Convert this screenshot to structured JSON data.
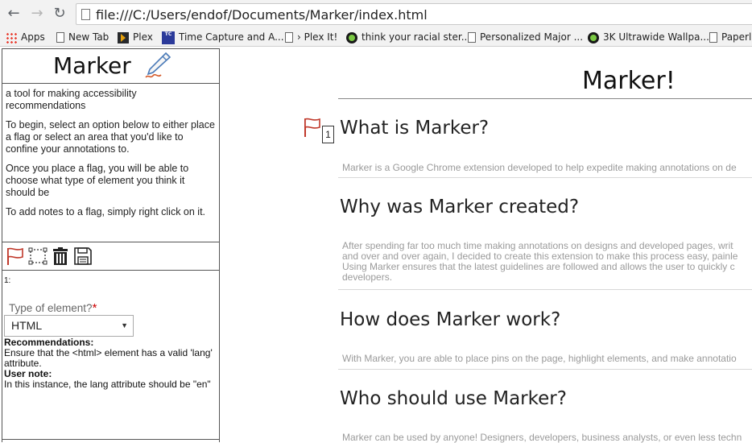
{
  "browser": {
    "url": "file:///C:/Users/endof/Documents/Marker/index.html",
    "bookmarks": [
      {
        "label": "Apps",
        "icon": "apps-grid-icon"
      },
      {
        "label": "New Tab",
        "icon": "page-icon"
      },
      {
        "label": "Plex",
        "icon": "plex-icon"
      },
      {
        "label": "Time Capture and A...",
        "icon": "time-capture-icon"
      },
      {
        "label": "› Plex It!",
        "icon": "page-icon"
      },
      {
        "label": "think your racial ster...",
        "icon": "green-circle-icon"
      },
      {
        "label": "Personalized Major ...",
        "icon": "page-icon"
      },
      {
        "label": "3K Ultrawide Wallpa...",
        "icon": "green-circle-icon"
      },
      {
        "label": "Paperle",
        "icon": "page-icon"
      }
    ]
  },
  "sidebar": {
    "logo": "Marker",
    "intro": [
      "a tool for making accessibility recommendations",
      "To begin, select an option below to either place a flag or select an area that you'd like to confine your annotations to.",
      "Once you place a flag, you will be able to choose what type of element you think it should be",
      "To add notes to a flag, simply right click on it."
    ],
    "tools": [
      "flag-icon",
      "select-area-icon",
      "trash-icon",
      "save-icon"
    ],
    "annotation": {
      "number": "1:",
      "type_label": "Type of element?",
      "required_mark": "*",
      "selected_type": "HTML",
      "recommendations_label": "Recommendations:",
      "recommendations_text": "Ensure that the <html> element has a valid 'lang' attribute.",
      "user_note_label": "User note:",
      "user_note_text": "In this instance, the lang attribute should be \"en\""
    }
  },
  "main": {
    "title": "Marker!",
    "flag_count": "1",
    "sections": [
      {
        "heading": "What is Marker?",
        "lines": [
          "Marker is a Google Chrome extension developed to help expedite making annotations on de"
        ]
      },
      {
        "heading": "Why was Marker created?",
        "lines": [
          "After spending far too much time making annotations on designs and developed pages, writ",
          "and over and over again, I decided to create this extension to make this process easy, painle",
          "Using Marker ensures that the latest guidelines are followed and allows the user to quickly c",
          "developers."
        ]
      },
      {
        "heading": "How does Marker work?",
        "lines": [
          "With Marker, you are able to place pins on the page, highlight elements, and make annotatio"
        ]
      },
      {
        "heading": "Who should use Marker?",
        "lines": [
          "Marker can be used by anyone! Designers, developers, business analysts, or even less techn"
        ]
      }
    ]
  }
}
